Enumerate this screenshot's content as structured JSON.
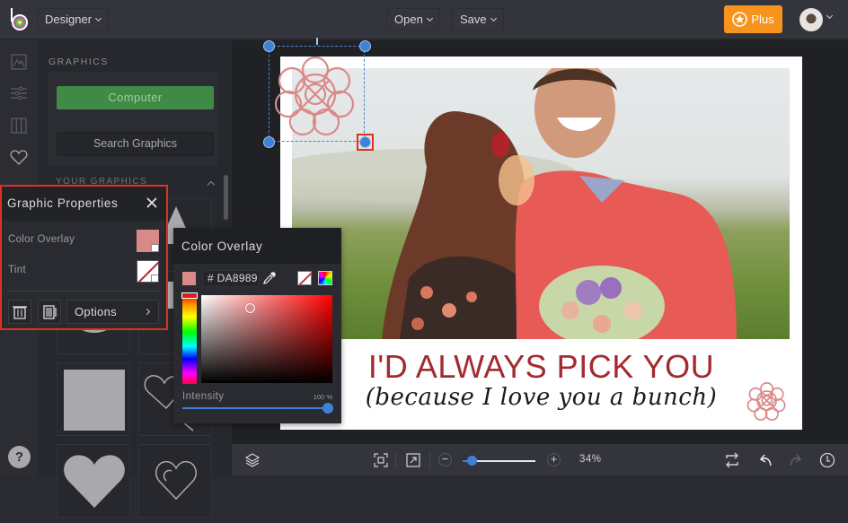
{
  "topbar": {
    "mode_label": "Designer",
    "open_label": "Open",
    "save_label": "Save",
    "plus_label": "Plus",
    "brand_color": "#f7941d"
  },
  "iconbar": {
    "icons": [
      "image-icon",
      "adjustments-icon",
      "frames-icon",
      "heart-icon"
    ],
    "help_label": "?"
  },
  "graphics_panel": {
    "title": "GRAPHICS",
    "computer_label": "Computer",
    "search_label": "Search Graphics",
    "section_title": "YOUR GRAPHICS"
  },
  "graphic_properties": {
    "title": "Graphic Properties",
    "color_overlay_label": "Color Overlay",
    "color_overlay_value": "#da8989",
    "tint_label": "Tint",
    "tint_value": "none",
    "options_label": "Options"
  },
  "color_overlay_popup": {
    "title": "Color Overlay",
    "hex_value": "# DA8989",
    "current_color": "#da8989",
    "intensity_label": "Intensity",
    "intensity_value": "100 %",
    "intensity_fraction": 1.0
  },
  "canvas": {
    "headline": "I'D ALWAYS PICK YOU",
    "subline": "(because I love you a bunch)",
    "headline_color": "#a32a30",
    "graphic_color": "#da8989"
  },
  "bottombar": {
    "zoom_value": "34%",
    "zoom_fraction": 0.08,
    "zoom_out_label": "−",
    "zoom_in_label": "+"
  }
}
